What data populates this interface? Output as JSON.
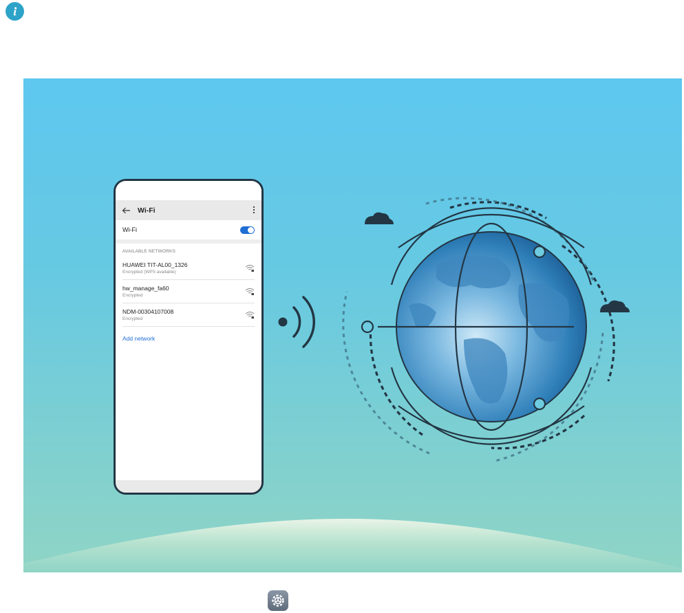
{
  "phone": {
    "title": "Wi-Fi",
    "wifi_toggle_label": "Wi-Fi",
    "wifi_enabled": true,
    "section_header": "AVAILABLE NETWORKS",
    "networks": [
      {
        "name": "HUAWEI TIT-AL00_1326",
        "status": "Encrypted (WPS available)"
      },
      {
        "name": "hw_manage_fa60",
        "status": "Encrypted"
      },
      {
        "name": "NDM-00304107008",
        "status": "Encrypted"
      }
    ],
    "add_network": "Add network"
  },
  "icons": {
    "info": "info-icon",
    "back": "back-arrow-icon",
    "more": "more-vertical-icon",
    "signal": "wifi-lock-icon",
    "settings": "settings-gear-icon",
    "globe": "globe-icon",
    "broadcast": "wireless-broadcast-icon",
    "cloud": "cloud-icon"
  },
  "colors": {
    "accent": "#1f6ed4",
    "sky_top": "#5ec8ef",
    "sky_bottom": "#8fd4c6",
    "outline": "#233644",
    "info": "#2ea3c9"
  }
}
